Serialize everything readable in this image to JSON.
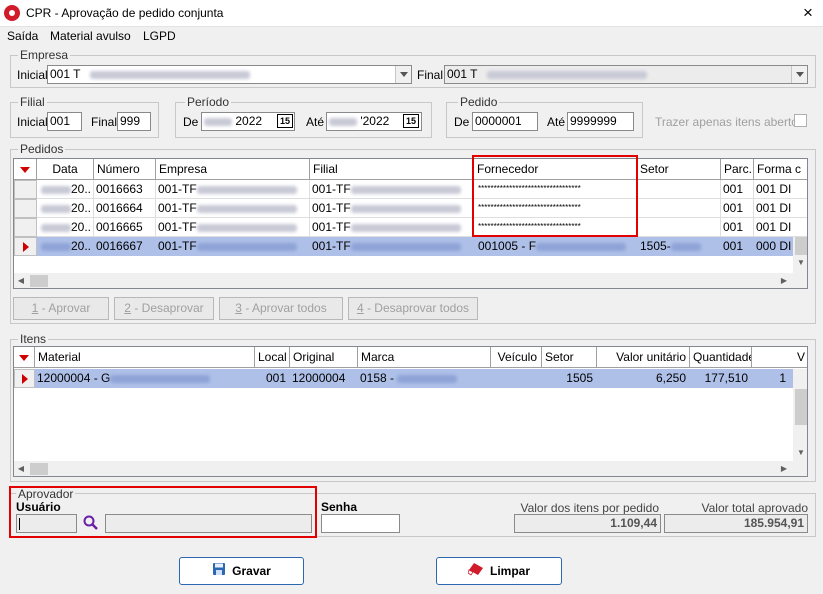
{
  "window": {
    "title": "CPR - Aprovação de pedido conjunta",
    "close_icon": "×"
  },
  "menu": [
    "Saída",
    "Material avulso",
    "LGPD"
  ],
  "empresa": {
    "label": "Empresa",
    "inicial_label": "Inicial",
    "inicial_value": "001 T",
    "final_label": "Final",
    "final_value": "001 T"
  },
  "filial": {
    "label": "Filial",
    "inicial_label": "Inicial",
    "inicial_value": "001",
    "final_label": "Final",
    "final_value": "999"
  },
  "periodo": {
    "label": "Período",
    "de_label": "De",
    "de_value": "2022",
    "ate_label": "Até",
    "ate_value": "'2022",
    "cal_icon": "15"
  },
  "pedido": {
    "label": "Pedido",
    "de_label": "De",
    "de_value": "0000001",
    "ate_label": "Até",
    "ate_value": "9999999"
  },
  "trazer_label": "Trazer apenas itens abertos",
  "pedidos": {
    "label": "Pedidos",
    "columns": [
      "Data",
      "Número",
      "Empresa",
      "Filial",
      "Fornecedor",
      "Setor",
      "Parc.",
      "Forma c"
    ],
    "rows": [
      {
        "data": "20..",
        "numero": "0016663",
        "empresa": "001-TF",
        "filial": "001-TF",
        "fornecedor": "*********************************",
        "setor": "",
        "parc": "001",
        "forma": "001  DI"
      },
      {
        "data": "20..",
        "numero": "0016664",
        "empresa": "001-TF",
        "filial": "001-TF",
        "fornecedor": "*********************************",
        "setor": "",
        "parc": "001",
        "forma": "001  DI"
      },
      {
        "data": "20..",
        "numero": "0016665",
        "empresa": "001-TF",
        "filial": "001-TF",
        "fornecedor": "*********************************",
        "setor": "",
        "parc": "001",
        "forma": "001  DI"
      },
      {
        "data": "20..",
        "numero": "0016667",
        "empresa": "001-TF",
        "filial": "001-TF",
        "fornecedor": "001005 - F",
        "setor": "1505-",
        "parc": "001",
        "forma": "000  DI"
      }
    ]
  },
  "actions": {
    "aprovar_key": "1",
    "aprovar": " - Aprovar",
    "desaprovar_key": "2",
    "desaprovar": " - Desaprovar",
    "aprovar_todos_key": "3",
    "aprovar_todos": " - Aprovar todos",
    "desaprovar_todos_key": "4",
    "desaprovar_todos": " - Desaprovar todos"
  },
  "itens": {
    "label": "Itens",
    "columns": [
      "Material",
      "Local",
      "Original",
      "Marca",
      "Veículo",
      "Setor",
      "Valor unitário",
      "Quantidade",
      "V"
    ],
    "rows": [
      {
        "material": "12000004 - G",
        "local": "001",
        "original": "12000004",
        "marca": "0158 - ",
        "veiculo": "",
        "setor": "1505",
        "valor_unitario": "6,250",
        "quantidade": "177,510",
        "v": "1"
      }
    ]
  },
  "aprovador": {
    "label": "Aprovador",
    "usuario_label": "Usuário",
    "senha_label": "Senha"
  },
  "totais": {
    "valor_itens_label": "Valor dos itens por pedido",
    "valor_itens": "1.109,44",
    "valor_total_label": "Valor total aprovado",
    "valor_total": "185.954,91"
  },
  "buttons": {
    "gravar": "Gravar",
    "limpar": "Limpar"
  },
  "colors": {
    "selection": "#aec0e8",
    "highlight": "#e20000",
    "indicator": "#d00000",
    "accent": "#2b68b0"
  }
}
